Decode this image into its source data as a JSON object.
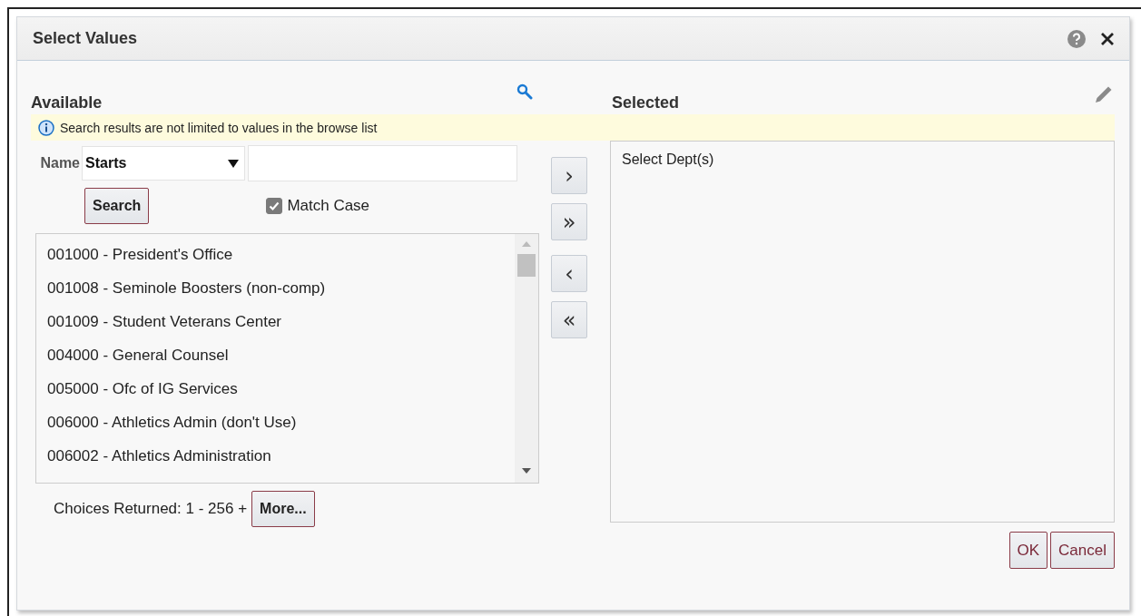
{
  "window": {
    "title": "Select Values"
  },
  "available": {
    "title": "Available",
    "notice": "Search results are not limited to values in the browse list",
    "filter": {
      "label": "Name",
      "operator": "Starts"
    },
    "search_button": "Search",
    "match_case": {
      "label": "Match Case",
      "checked": true
    },
    "items": [
      {
        "label": "001000 - President's Office",
        "selected": false
      },
      {
        "label": "001008 - Seminole Boosters (non-comp)",
        "selected": false
      },
      {
        "label": "001009 - Student Veterans Center",
        "selected": false
      },
      {
        "label": "004000 - General Counsel",
        "selected": false
      },
      {
        "label": "005000 - Ofc of IG Services",
        "selected": false
      },
      {
        "label": "006000 - Athletics Admin (don't Use)",
        "selected": false
      },
      {
        "label": "006002 - Athletics Administration",
        "selected": false
      }
    ],
    "choices_returned": "Choices Returned: 1 - 256 +",
    "more_button": "More..."
  },
  "move_buttons": [
    "›",
    "»",
    "‹",
    "«"
  ],
  "selected": {
    "title": "Selected",
    "items": [
      "Select Dept(s)"
    ]
  },
  "buttons": [
    "OK",
    "Cancel"
  ]
}
